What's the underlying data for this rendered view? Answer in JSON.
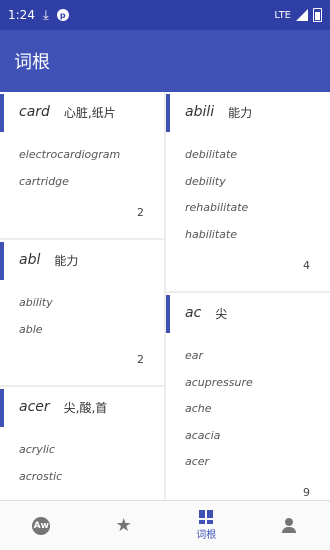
{
  "status_bar": {
    "time": "1:24",
    "network": "LTE"
  },
  "app_bar": {
    "title": "词根"
  },
  "cards": [
    {
      "root": "card",
      "meaning": "心脏,纸片",
      "words": [
        "electrocardiogram",
        "cartridge"
      ],
      "count": "2"
    },
    {
      "root": "abili",
      "meaning": "能力",
      "words": [
        "debilitate",
        "debility",
        "rehabilitate",
        "habilitate"
      ],
      "count": "4"
    },
    {
      "root": "abl",
      "meaning": "能力",
      "words": [
        "ability",
        "able"
      ],
      "count": "2"
    },
    {
      "root": "ac",
      "meaning": "尖",
      "words": [
        "ear",
        "acupressure",
        "ache",
        "acacia",
        "acer"
      ],
      "count": "9"
    },
    {
      "root": "acer",
      "meaning": "尖,酸,首",
      "words": [
        "acrylic",
        "acrostic"
      ],
      "count": ""
    }
  ],
  "bottom_nav": [
    {
      "icon": "aw-icon",
      "label": ""
    },
    {
      "icon": "star-icon",
      "label": ""
    },
    {
      "icon": "dashboard-icon",
      "label": "词根"
    },
    {
      "icon": "person-icon",
      "label": ""
    }
  ],
  "colors": {
    "primary": "#3f51b5",
    "primary_dark": "#2f3fa6"
  }
}
